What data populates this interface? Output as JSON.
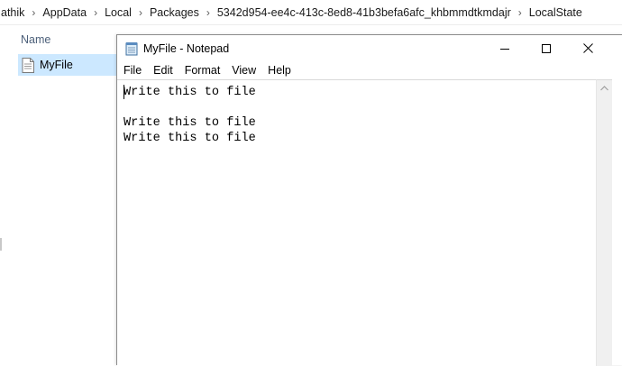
{
  "explorer": {
    "breadcrumb": [
      "athik",
      "AppData",
      "Local",
      "Packages",
      "5342d954-ee4c-413c-8ed8-41b3befa6afc_khbmmdtkmdajr",
      "LocalState"
    ],
    "column_name": "Name",
    "file_label": "MyFile"
  },
  "notepad": {
    "title": "MyFile - Notepad",
    "menu": [
      "File",
      "Edit",
      "Format",
      "View",
      "Help"
    ],
    "content": "Write this to file\n\nWrite this to file\nWrite this to file"
  },
  "colors": {
    "selection": "#cce8ff",
    "column_header_text": "#4c607a"
  },
  "icons": {
    "notepad": "notepad-app-icon",
    "file": "text-file-icon",
    "minimize": "minimize-icon",
    "maximize": "maximize-icon",
    "close": "close-icon"
  }
}
